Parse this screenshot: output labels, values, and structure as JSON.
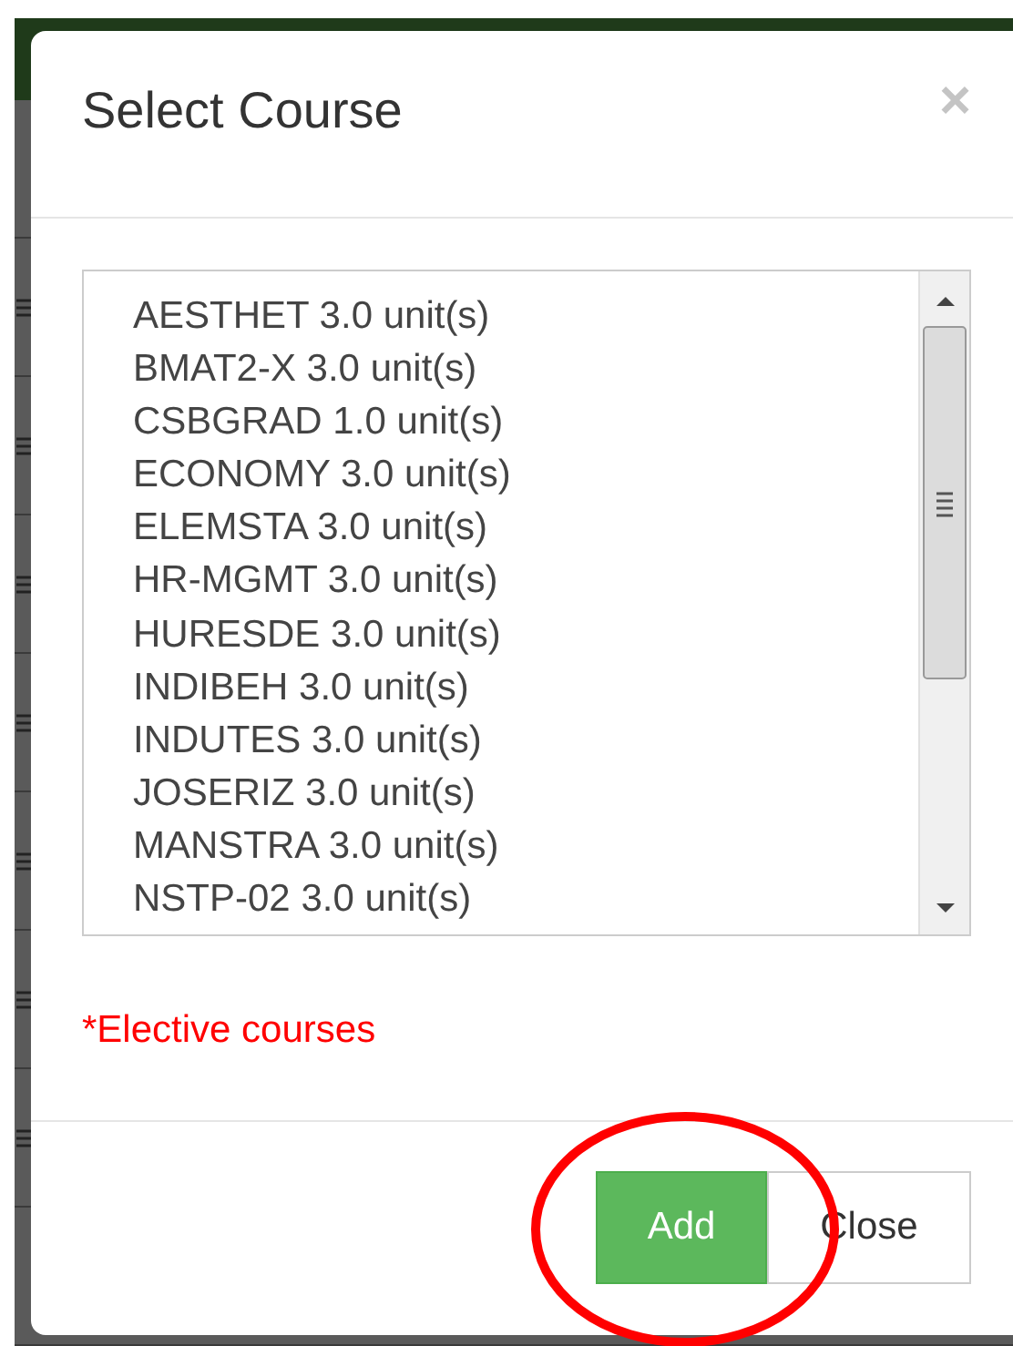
{
  "dialog": {
    "title": "Select Course",
    "close_symbol": "×"
  },
  "courses": [
    "AESTHET 3.0 unit(s)",
    "BMAT2-X 3.0 unit(s)",
    "CSBGRAD 1.0 unit(s)",
    "ECONOMY 3.0 unit(s)",
    "ELEMSTA 3.0 unit(s)",
    "HR-MGMT 3.0 unit(s)",
    "HURESDE 3.0 unit(s)",
    "INDIBEH 3.0 unit(s)",
    "INDUTES 3.0 unit(s)",
    "JOSERIZ 3.0 unit(s)",
    "MANSTRA 3.0 unit(s)",
    "NSTP-02 3.0 unit(s)"
  ],
  "note": "*Elective courses",
  "buttons": [
    {
      "label": "Add",
      "kind": "primary"
    },
    {
      "label": "Close",
      "kind": "default"
    }
  ]
}
